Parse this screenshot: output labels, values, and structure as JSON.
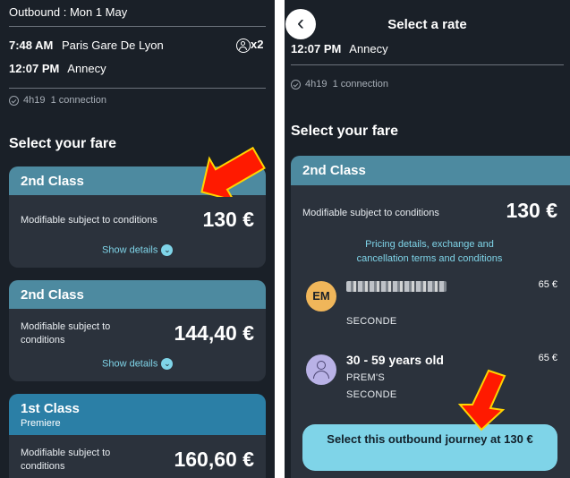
{
  "left": {
    "outbound_title": "Outbound : Mon 1 May",
    "departure_time": "7:48 AM",
    "departure_station": "Paris Gare De Lyon",
    "passenger_count": "x2",
    "arrival_time": "12:07 PM",
    "arrival_station": "Annecy",
    "duration": "4h19",
    "connections": "1 connection",
    "section_title": "Select your fare",
    "fares": [
      {
        "class": "2nd Class",
        "subclass": "",
        "description": "Modifiable subject to conditions",
        "price": "130 €",
        "details": "Show details"
      },
      {
        "class": "2nd Class",
        "subclass": "",
        "description": "Modifiable subject to conditions",
        "price": "144,40 €",
        "details": "Show details"
      },
      {
        "class": "1st Class",
        "subclass": "Premiere",
        "description": "Modifiable subject to conditions",
        "price": "160,60 €"
      }
    ]
  },
  "right": {
    "header_title": "Select a rate",
    "arrival_time": "12:07 PM",
    "arrival_station": "Annecy",
    "duration": "4h19",
    "connections": "1 connection",
    "section_title": "Select your fare",
    "fare_class": "2nd Class",
    "fare_description": "Modifiable subject to conditions",
    "fare_price": "130 €",
    "pricing_link": "Pricing details, exchange and cancellation terms and conditions",
    "passengers": [
      {
        "initials": "EM",
        "name": "",
        "lines": [
          "SECONDE"
        ],
        "amount": "65 €"
      },
      {
        "initials": "",
        "name": "30 - 59 years old",
        "lines": [
          "PREM'S",
          "SECONDE"
        ],
        "amount": "65 €"
      }
    ],
    "select_button": "Select this outbound journey at 130 €"
  },
  "colors": {
    "background": "#1a2028",
    "card": "#2b323c",
    "card_header": "#4d8aa0",
    "card_header_first": "#2b7fa6",
    "accent": "#7fd4e8",
    "button": "#7fd4e8",
    "annotation_arrow": "#ff1a00"
  },
  "icons": {
    "back": "chevron-left-icon",
    "passenger": "person-circle-icon",
    "duration": "clock-icon",
    "details": "chevron-down-icon"
  }
}
